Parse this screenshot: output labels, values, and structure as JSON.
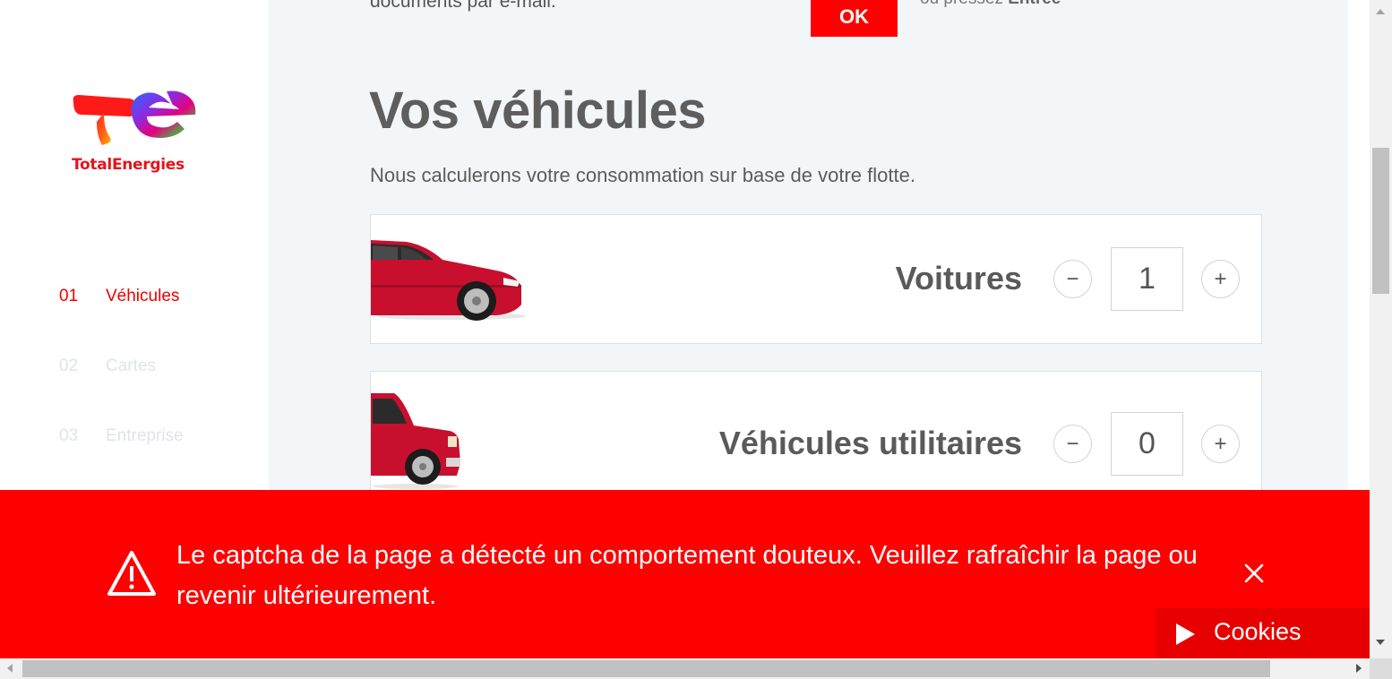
{
  "brand": {
    "name": "TotalEnergies",
    "color": "#e4141b"
  },
  "sidebar": {
    "steps": [
      {
        "num": "01",
        "label": "Véhicules",
        "state": "active"
      },
      {
        "num": "02",
        "label": "Cartes",
        "state": "inactive"
      },
      {
        "num": "03",
        "label": "Entreprise",
        "state": "inactive"
      }
    ]
  },
  "top": {
    "partial_text": "documents par e-mail.",
    "ok_label": "OK",
    "hint_prefix": "ou pressez ",
    "hint_key": "Entrée"
  },
  "vehicles": {
    "title": "Vos véhicules",
    "subtitle": "Nous calculerons votre consommation sur base de votre flotte.",
    "items": [
      {
        "label": "Voitures",
        "minus": "−",
        "value": "1",
        "plus": "+",
        "image": "red-car-icon"
      },
      {
        "label": "Véhicules utilitaires",
        "minus": "−",
        "value": "0",
        "plus": "+",
        "image": "red-van-icon"
      }
    ]
  },
  "alert": {
    "message": "Le captcha de la page a détecté un comportement douteux. Veuillez rafraîchir la page ou revenir ultérieurement.",
    "icon": "warning-icon",
    "close_icon": "close-icon",
    "color": "#ff0000"
  },
  "cookies": {
    "label": "Cookies"
  }
}
